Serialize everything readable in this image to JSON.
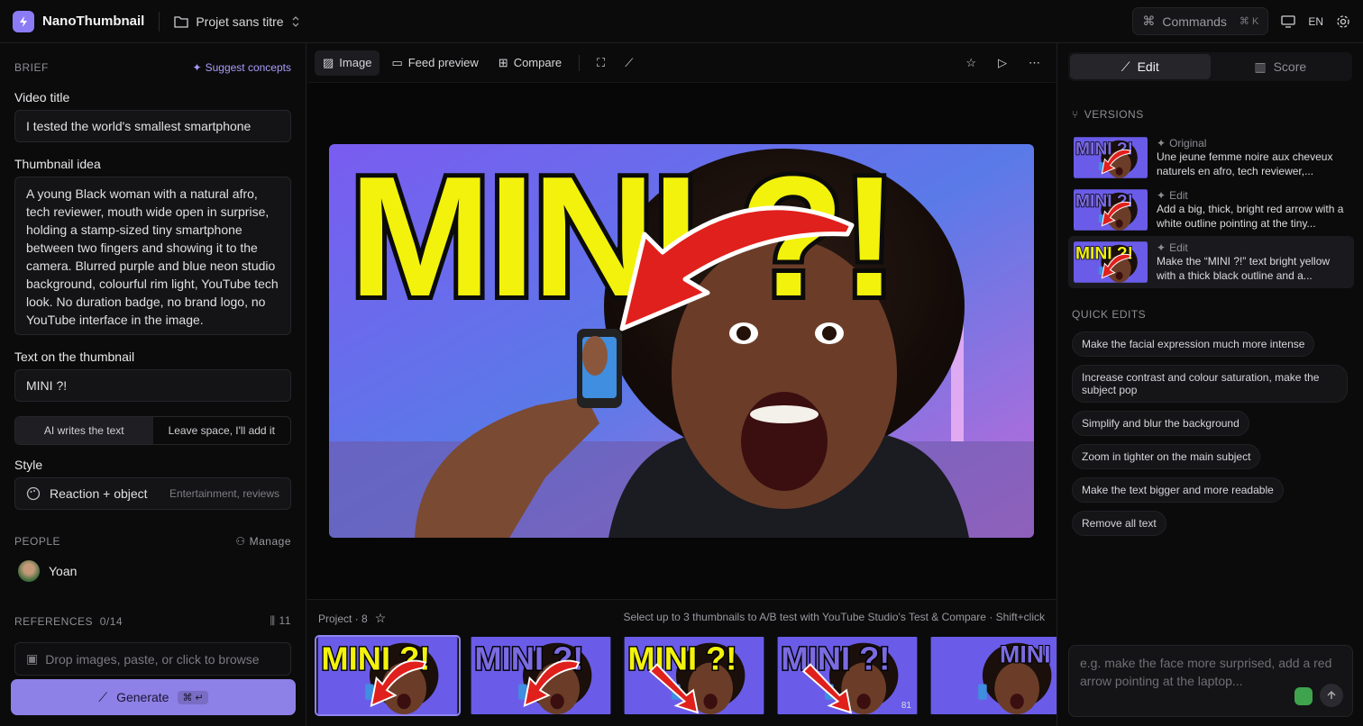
{
  "app": {
    "name": "NanoThumbnail",
    "project": "Projet sans titre"
  },
  "topbar": {
    "commands_label": "Commands",
    "commands_shortcut": "⌘ K",
    "lang": "EN"
  },
  "brief": {
    "header": "BRIEF",
    "suggest": "Suggest concepts",
    "video_title_label": "Video title",
    "video_title": "I tested the world's smallest smartphone",
    "idea_label": "Thumbnail idea",
    "idea": "A young Black woman with a natural afro, tech reviewer, mouth wide open in surprise, holding a stamp-sized tiny smartphone between two fingers and showing it to the camera. Blurred purple and blue neon studio background, colourful rim light, YouTube tech look. No duration badge, no brand logo, no YouTube interface in the image.",
    "text_label": "Text on the thumbnail",
    "text": "MINI ?!",
    "text_mode": [
      "AI writes the text",
      "Leave space, I'll add it"
    ],
    "style_label": "Style",
    "style_name": "Reaction + object",
    "style_hint": "Entertainment, reviews",
    "people_header": "PEOPLE",
    "manage": "Manage",
    "person": "Yoan",
    "refs_header": "REFERENCES",
    "refs_count": "0/14",
    "refs_lib": "11",
    "drop": "Drop images, paste, or click to browse",
    "generate": "Generate",
    "generate_kbd": "⌘ ↵"
  },
  "center": {
    "tools": [
      "Image",
      "Feed preview",
      "Compare"
    ],
    "hero_text": "MINI ?!",
    "strip_left": "Project · 8",
    "strip_right": "Select up to 3 thumbnails to A/B test with YouTube Studio's Test & Compare · Shift+click",
    "thumb_texts": [
      "MINI ?!",
      "MINI ?!",
      "MINI ?!",
      "MINI ?!",
      "MINI"
    ],
    "thumb_badge": "81"
  },
  "right": {
    "tabs": [
      "Edit",
      "Score"
    ],
    "versions_header": "VERSIONS",
    "versions": [
      {
        "tag": "Original",
        "desc": "Une jeune femme noire aux cheveux naturels en afro, tech reviewer,..."
      },
      {
        "tag": "Edit",
        "desc": "Add a big, thick, bright red arrow with a white outline pointing at the tiny..."
      },
      {
        "tag": "Edit",
        "desc": "Make the “MINI ?!” text bright yellow with a thick black outline and a..."
      }
    ],
    "quick_header": "QUICK EDITS",
    "quick": [
      "Make the facial expression much more intense",
      "Increase contrast and colour saturation, make the subject pop",
      "Simplify and blur the background",
      "Zoom in tighter on the main subject",
      "Make the text bigger and more readable",
      "Remove all text"
    ],
    "prompt_placeholder": "e.g. make the face more surprised, add a red arrow pointing at the laptop..."
  },
  "colors": {
    "accent": "#8d80e6",
    "yellow": "#f2f20c",
    "arrow": "#e0201c"
  }
}
